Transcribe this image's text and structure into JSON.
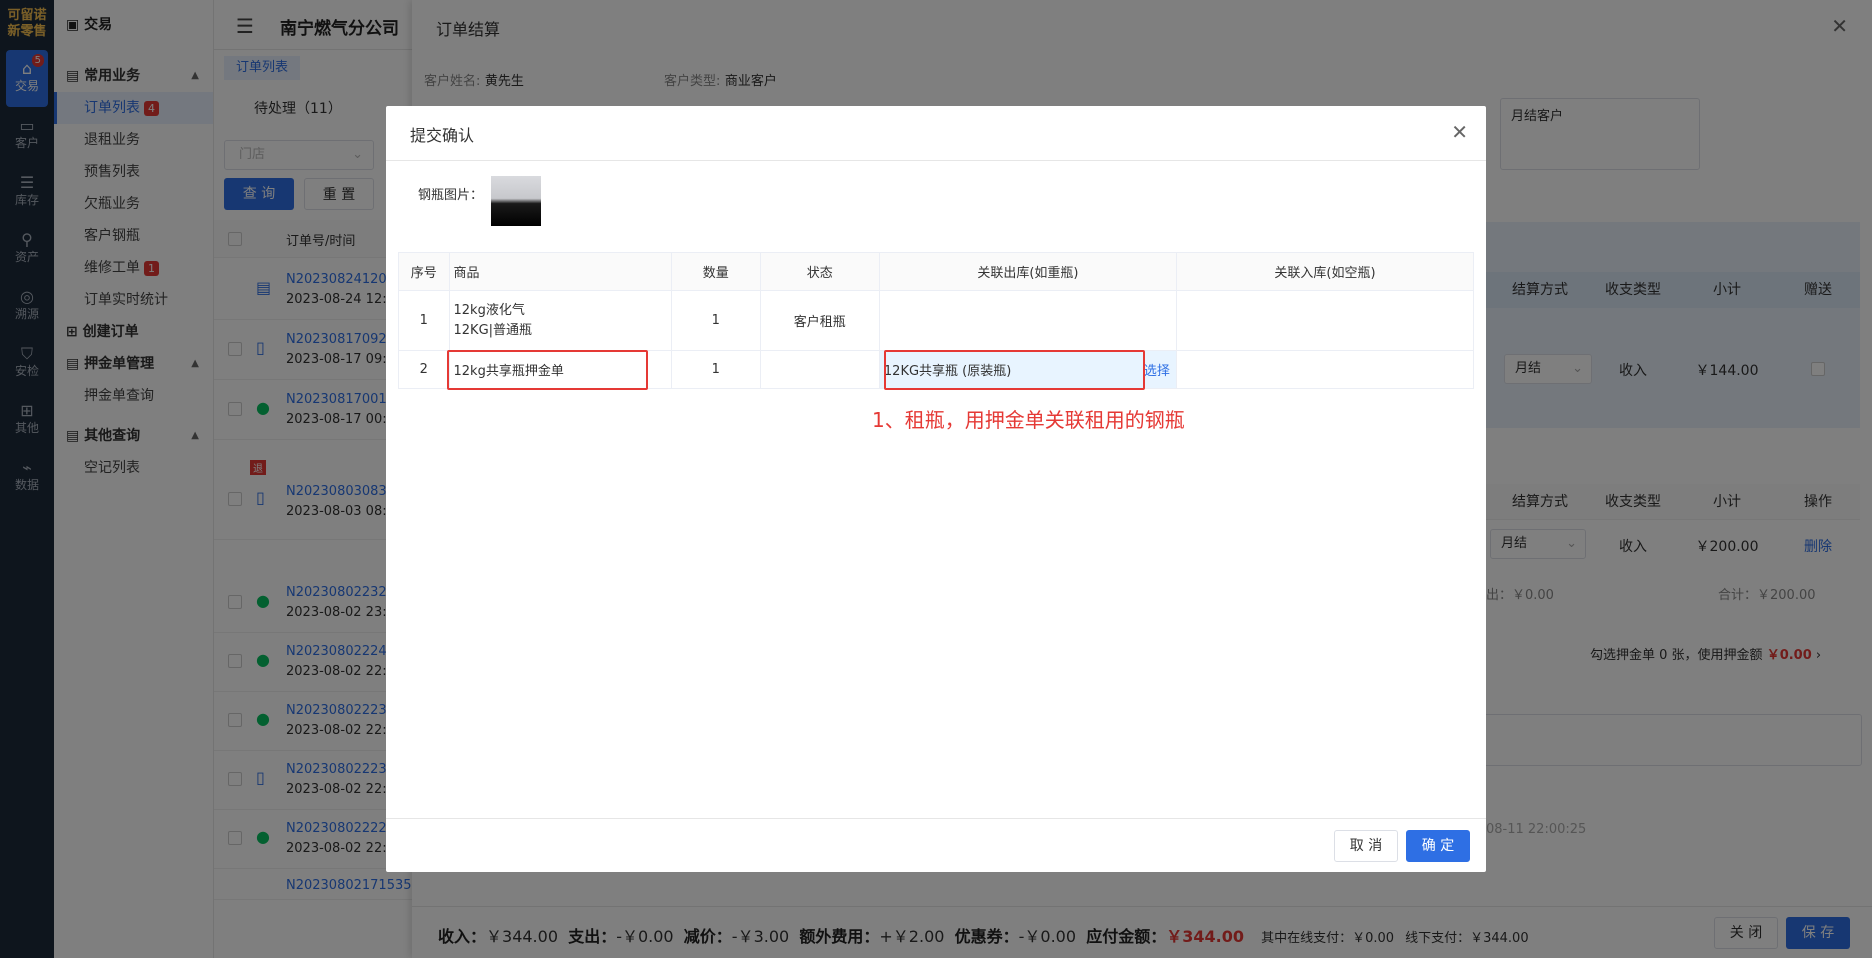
{
  "rail": {
    "logo_top": "可留诺",
    "logo_bottom": "新零售",
    "items": [
      {
        "label": "交易",
        "icon": "cart-icon",
        "badge": "5",
        "active": true
      },
      {
        "label": "客户",
        "icon": "id-card-icon"
      },
      {
        "label": "库存",
        "icon": "list-icon"
      },
      {
        "label": "资产",
        "icon": "pin-icon"
      },
      {
        "label": "溯源",
        "icon": "compass-icon"
      },
      {
        "label": "安检",
        "icon": "shield-icon"
      },
      {
        "label": "其他",
        "icon": "blocks-icon"
      },
      {
        "label": "数据",
        "icon": "chart-icon"
      }
    ]
  },
  "sidebar": {
    "title": "交易",
    "groups": [
      {
        "label": "常用业务",
        "items": [
          {
            "label": "订单列表",
            "badge": "4",
            "active": true
          },
          {
            "label": "退租业务"
          },
          {
            "label": "预售列表"
          },
          {
            "label": "欠瓶业务"
          },
          {
            "label": "客户钢瓶"
          },
          {
            "label": "维修工单",
            "badge": "1"
          },
          {
            "label": "订单实时统计"
          }
        ]
      },
      {
        "label": "创建订单",
        "items": []
      },
      {
        "label": "押金单管理",
        "items": [
          {
            "label": "押金单查询"
          }
        ]
      },
      {
        "label": "其他查询",
        "items": [
          {
            "label": "空记列表"
          }
        ]
      }
    ]
  },
  "header": {
    "company": "南宁燃气分公司",
    "tab": "订单列表"
  },
  "list": {
    "pending_tab": "待处理（11）",
    "store_placeholder": "门店",
    "query_btn": "查 询",
    "reset_btn": "重 置",
    "col_order": "订单号/时间",
    "rows": [
      {
        "no": "N202308241202",
        "time": "2023-08-24 12:0"
      },
      {
        "no": "N202308170922",
        "time": "2023-08-17 09:2"
      },
      {
        "no": "N202308170019",
        "time": "2023-08-17 00:1"
      },
      {
        "no": "N202308030833",
        "time": "2023-08-03 08:3"
      },
      {
        "no": "N202308022325",
        "time": "2023-08-02 23:2"
      },
      {
        "no": "N202308022242",
        "time": "2023-08-02 22:4"
      },
      {
        "no": "N202308022234",
        "time": "2023-08-02 22:3"
      },
      {
        "no": "N202308022233",
        "time": "2023-08-02 22:2"
      },
      {
        "no": "N202308022220",
        "time": "2023-08-02 22:2"
      },
      {
        "no": "N20230802171535",
        "time": ""
      }
    ],
    "return_tag": "退"
  },
  "drawer": {
    "title": "订单结算",
    "customer_name_label": "客户姓名:",
    "customer_name": "黄先生",
    "customer_type_label": "客户类型:",
    "customer_type": "商业客户",
    "pay_type_value": "月结客户",
    "table1": {
      "headers": [
        "结算方式",
        "收支类型",
        "小计",
        "赠送"
      ],
      "row": {
        "method": "月结",
        "type": "收入",
        "subtotal": "￥144.00"
      }
    },
    "table2": {
      "headers": [
        "结算方式",
        "收支类型",
        "小计",
        "操作"
      ],
      "row": {
        "method": "月结",
        "type": "收入",
        "subtotal": "￥200.00",
        "op": "删除"
      },
      "out": "出：￥0.00",
      "total": "合计：￥200.00"
    },
    "deposit_hint": "勾选押金单 0 张，使用押金额",
    "deposit_amount": "￥0.00",
    "time_hint": "08-11 22:00:25",
    "footer": {
      "income_label": "收入：",
      "income": "￥344.00",
      "expense_label": "支出：",
      "expense": "-￥0.00",
      "discount_label": "减价：",
      "discount": "-￥3.00",
      "extra_label": "额外费用：",
      "extra": "+￥2.00",
      "coupon_label": "优惠券：",
      "coupon": "-￥0.00",
      "payable_label": "应付金额：",
      "payable": "￥344.00",
      "online": "其中在线支付：￥0.00",
      "offline": "线下支付：￥344.00",
      "close_btn": "关 闭",
      "save_btn": "保 存"
    }
  },
  "dialog": {
    "title": "提交确认",
    "image_label": "钢瓶图片：",
    "headers": [
      "序号",
      "商品",
      "数量",
      "状态",
      "关联出库(如重瓶)",
      "关联入库(如空瓶)"
    ],
    "rows": [
      {
        "idx": "1",
        "product_line1": "12kg液化气",
        "product_line2": "12KG|普通瓶",
        "qty": "1",
        "status": "客户租瓶",
        "out": "",
        "out_action": "",
        "in": ""
      },
      {
        "idx": "2",
        "product_line1": "12kg共享瓶押金单",
        "product_line2": "",
        "qty": "1",
        "status": "",
        "out": "12KG共享瓶 (原装瓶)",
        "out_action": "选择",
        "in": ""
      }
    ],
    "annotation": "1、租瓶，用押金单关联租用的钢瓶",
    "cancel_btn": "取 消",
    "ok_btn": "确 定"
  }
}
